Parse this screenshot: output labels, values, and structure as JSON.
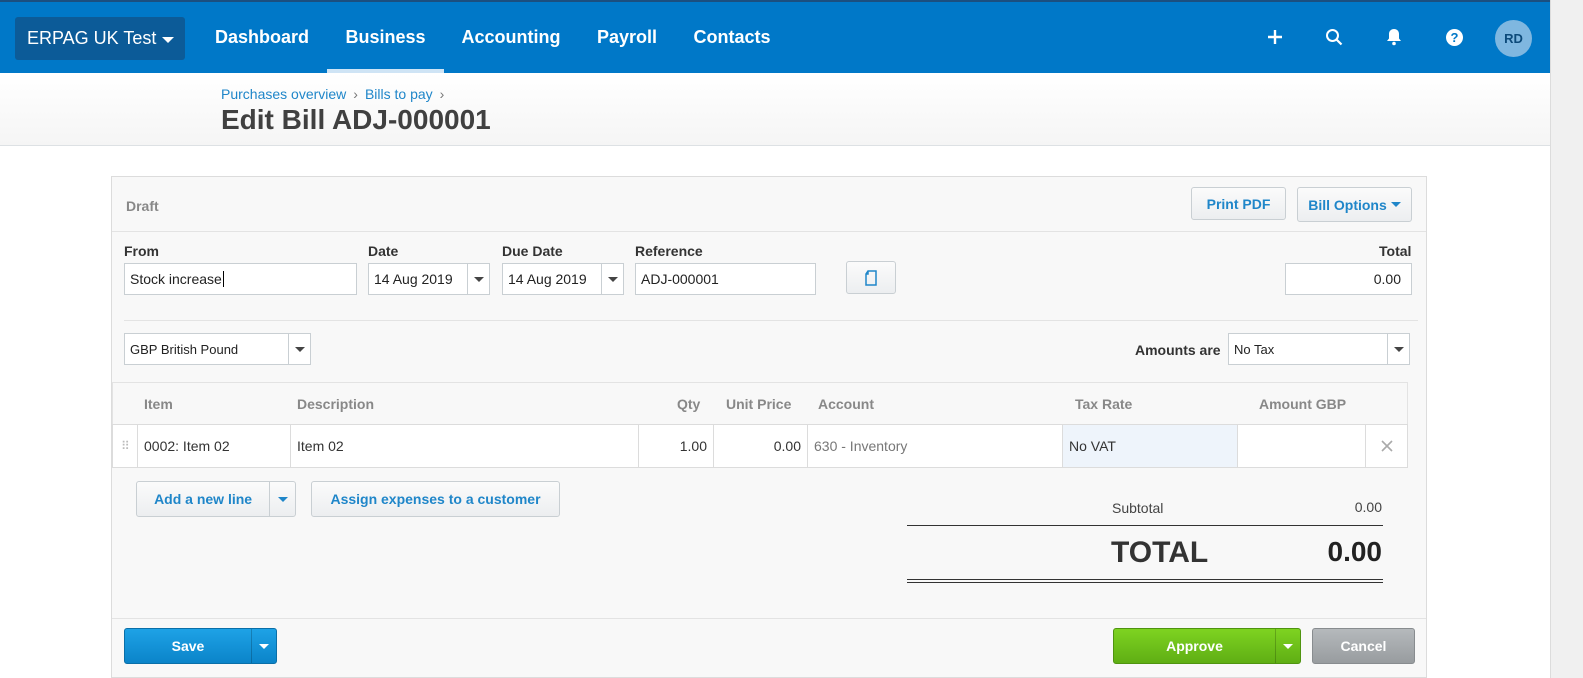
{
  "nav": {
    "org": "ERPAG UK Test",
    "items": [
      {
        "label": "Dashboard"
      },
      {
        "label": "Business"
      },
      {
        "label": "Accounting"
      },
      {
        "label": "Payroll"
      },
      {
        "label": "Contacts"
      }
    ],
    "active_item": "Business",
    "avatar_initials": "RD",
    "icons": [
      "plus-icon",
      "search-icon",
      "bell-icon",
      "help-icon"
    ]
  },
  "breadcrumb": [
    "Purchases overview",
    "Bills to pay"
  ],
  "breadcrumb_sep": "›",
  "page_title": "Edit Bill ADJ-000001",
  "bill": {
    "status": "Draft",
    "print_pdf": "Print PDF",
    "bill_options": "Bill Options",
    "from_label": "From",
    "from_value": "Stock increase",
    "date_label": "Date",
    "date_value": "14 Aug 2019",
    "due_date_label": "Due Date",
    "due_date_value": "14 Aug 2019",
    "reference_label": "Reference",
    "reference_value": "ADJ-000001",
    "total_label": "Total",
    "total_value": "0.00",
    "currency": "GBP British Pound",
    "amounts_are_label": "Amounts are",
    "amounts_are_value": "No Tax"
  },
  "table": {
    "headers": [
      "Item",
      "Description",
      "Qty",
      "Unit Price",
      "Account",
      "Tax Rate",
      "Amount GBP"
    ],
    "rows": [
      {
        "item": "0002: Item 02",
        "description": "Item 02",
        "qty": "1.00",
        "unit_price": "0.00",
        "account": "630 - Inventory",
        "tax_rate": "No VAT",
        "amount": ""
      }
    ]
  },
  "actions": {
    "add_line": "Add a new line",
    "assign_expenses": "Assign expenses to a customer",
    "save": "Save",
    "approve": "Approve",
    "cancel": "Cancel"
  },
  "totals": {
    "subtotal_label": "Subtotal",
    "subtotal_value": "0.00",
    "total_label": "TOTAL",
    "total_value": "0.00"
  },
  "colors": {
    "nav_bg": "#0078c8",
    "link": "#1f86c9",
    "save": "#0e8fd6",
    "approve": "#6cbf1d",
    "cancel": "#a4a8ab"
  }
}
